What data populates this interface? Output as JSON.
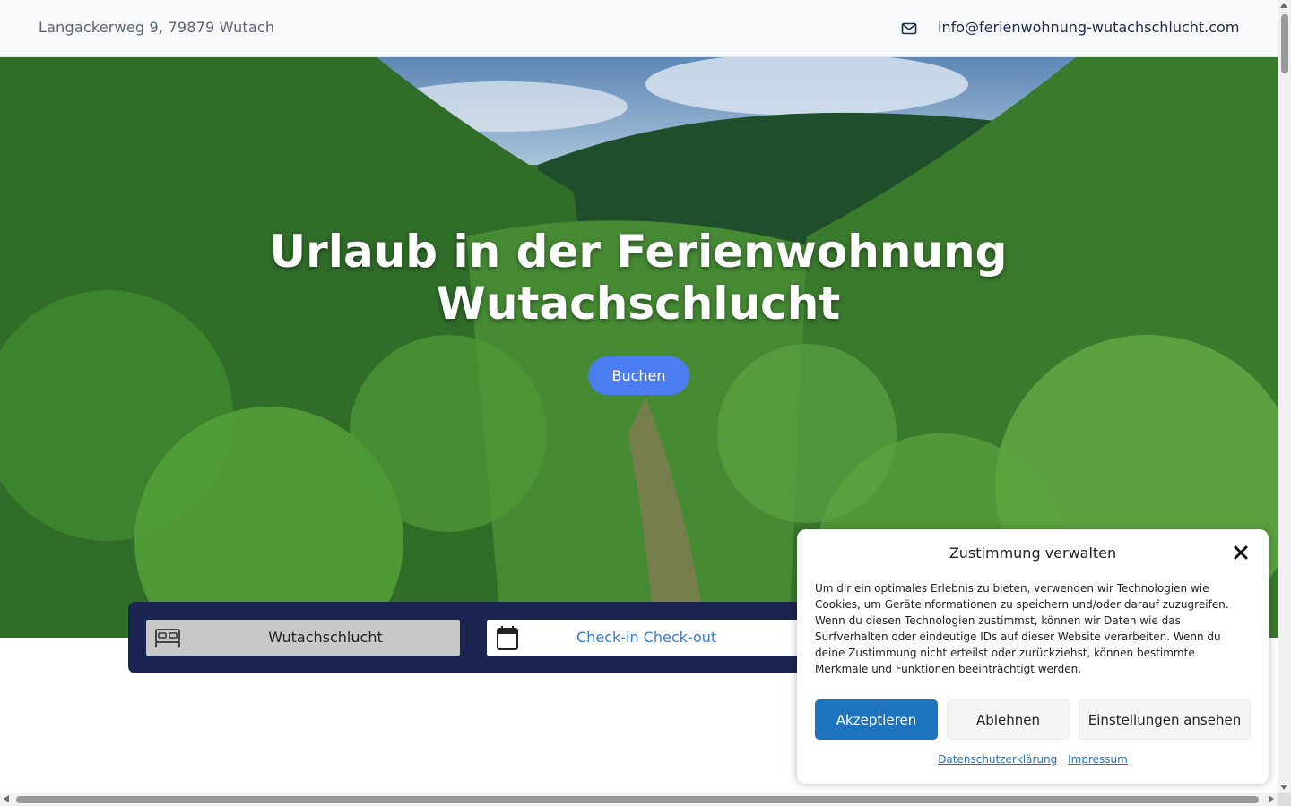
{
  "header": {
    "address": "Langackerweg 9, 79879 Wutach",
    "mail_icon": "envelope-icon",
    "email": "info@ferienwohnung-wutachschlucht.com"
  },
  "hero": {
    "title_line1": "Urlaub in der Ferienwohnung",
    "title_line2": "Wutachschlucht",
    "button_label": "Buchen",
    "button_color": "#4b7cf0"
  },
  "booking": {
    "property_icon": "bed-icon",
    "property_value": "Wutachschlucht",
    "dates_icon": "calendar-icon",
    "dates_placeholder": "Check-in Check-out",
    "bar_color": "#1b2450"
  },
  "consent": {
    "title": "Zustimmung verwalten",
    "close_icon": "close-icon",
    "text": "Um dir ein optimales Erlebnis zu bieten, verwenden wir Technologien wie Cookies, um Geräteinformationen zu speichern und/oder darauf zuzugreifen. Wenn du diesen Technologien zustimmst, können wir Daten wie das Surfverhalten oder eindeutige IDs auf dieser Website verarbeiten. Wenn du deine Zustimmung nicht erteilst oder zurückziehst, können bestimmte Merkmale und Funktionen beeinträchtigt werden.",
    "accept_label": "Akzeptieren",
    "deny_label": "Ablehnen",
    "prefs_label": "Einstellungen ansehen",
    "privacy_link": "Datenschutzerklärung",
    "imprint_link": "Impressum",
    "accent_color": "#1e73be"
  }
}
